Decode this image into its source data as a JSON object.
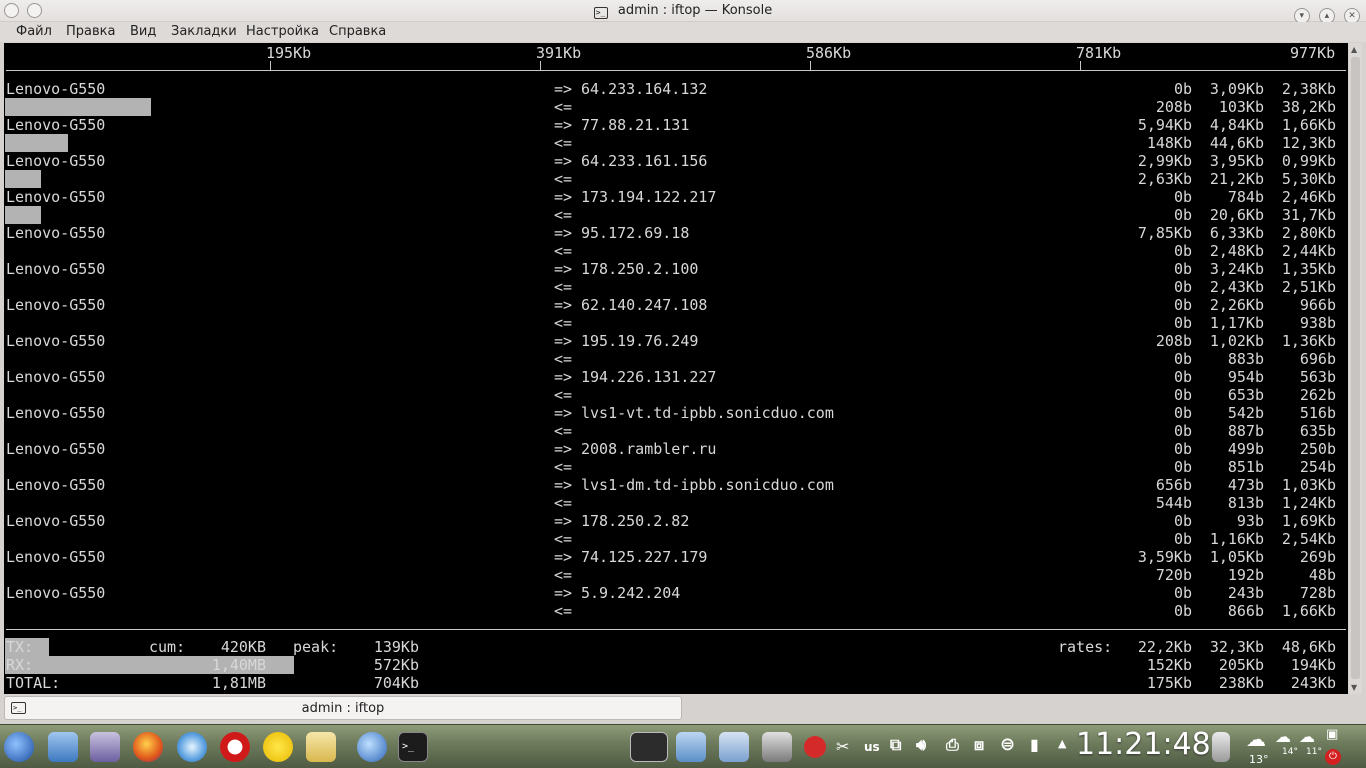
{
  "window": {
    "title": "admin : iftop — Konsole",
    "min_btn": "▾",
    "max_btn": "▴",
    "close_btn": "✕"
  },
  "menu": [
    "Файл",
    "Правка",
    "Вид",
    "Закладки",
    "Настройка",
    "Справка"
  ],
  "scale": [
    "195Kb",
    "391Kb",
    "586Kb",
    "781Kb",
    "977Kb"
  ],
  "connections": [
    {
      "host": "Lenovo-G550",
      "dest": "64.233.164.132",
      "out": [
        "0b",
        "3,09Kb",
        "2,38Kb"
      ],
      "in": [
        "208b",
        "103Kb",
        "38,2Kb"
      ],
      "bar_out": 0,
      "bar_in": 0.146
    },
    {
      "host": "Lenovo-G550",
      "dest": "77.88.21.131",
      "out": [
        "5,94Kb",
        "4,84Kb",
        "1,66Kb"
      ],
      "in": [
        "148Kb",
        "44,6Kb",
        "12,3Kb"
      ],
      "bar_out": 0,
      "bar_in": 0.063
    },
    {
      "host": "Lenovo-G550",
      "dest": "64.233.161.156",
      "out": [
        "2,99Kb",
        "3,95Kb",
        "0,99Kb"
      ],
      "in": [
        "2,63Kb",
        "21,2Kb",
        "5,30Kb"
      ],
      "bar_out": 0,
      "bar_in": 0.036
    },
    {
      "host": "Lenovo-G550",
      "dest": "173.194.122.217",
      "out": [
        "0b",
        "784b",
        "2,46Kb"
      ],
      "in": [
        "0b",
        "20,6Kb",
        "31,7Kb"
      ],
      "bar_out": 0,
      "bar_in": 0.036
    },
    {
      "host": "Lenovo-G550",
      "dest": "95.172.69.18",
      "out": [
        "7,85Kb",
        "6,33Kb",
        "2,80Kb"
      ],
      "in": [
        "0b",
        "2,48Kb",
        "2,44Kb"
      ],
      "bar_out": 0,
      "bar_in": 0
    },
    {
      "host": "Lenovo-G550",
      "dest": "178.250.2.100",
      "out": [
        "0b",
        "3,24Kb",
        "1,35Kb"
      ],
      "in": [
        "0b",
        "2,43Kb",
        "2,51Kb"
      ],
      "bar_out": 0,
      "bar_in": 0
    },
    {
      "host": "Lenovo-G550",
      "dest": "62.140.247.108",
      "out": [
        "0b",
        "2,26Kb",
        "966b"
      ],
      "in": [
        "0b",
        "1,17Kb",
        "938b"
      ],
      "bar_out": 0,
      "bar_in": 0
    },
    {
      "host": "Lenovo-G550",
      "dest": "195.19.76.249",
      "out": [
        "208b",
        "1,02Kb",
        "1,36Kb"
      ],
      "in": [
        "0b",
        "883b",
        "696b"
      ],
      "bar_out": 0,
      "bar_in": 0
    },
    {
      "host": "Lenovo-G550",
      "dest": "194.226.131.227",
      "out": [
        "0b",
        "954b",
        "563b"
      ],
      "in": [
        "0b",
        "653b",
        "262b"
      ],
      "bar_out": 0,
      "bar_in": 0
    },
    {
      "host": "Lenovo-G550",
      "dest": "lvs1-vt.td-ipbb.sonicduo.com",
      "out": [
        "0b",
        "542b",
        "516b"
      ],
      "in": [
        "0b",
        "887b",
        "635b"
      ],
      "bar_out": 0,
      "bar_in": 0
    },
    {
      "host": "Lenovo-G550",
      "dest": "2008.rambler.ru",
      "out": [
        "0b",
        "499b",
        "250b"
      ],
      "in": [
        "0b",
        "851b",
        "254b"
      ],
      "bar_out": 0,
      "bar_in": 0
    },
    {
      "host": "Lenovo-G550",
      "dest": "lvs1-dm.td-ipbb.sonicduo.com",
      "out": [
        "656b",
        "473b",
        "1,03Kb"
      ],
      "in": [
        "544b",
        "813b",
        "1,24Kb"
      ],
      "bar_out": 0,
      "bar_in": 0
    },
    {
      "host": "Lenovo-G550",
      "dest": "178.250.2.82",
      "out": [
        "0b",
        "93b",
        "1,69Kb"
      ],
      "in": [
        "0b",
        "1,16Kb",
        "2,54Kb"
      ],
      "bar_out": 0,
      "bar_in": 0
    },
    {
      "host": "Lenovo-G550",
      "dest": "74.125.227.179",
      "out": [
        "3,59Kb",
        "1,05Kb",
        "269b"
      ],
      "in": [
        "720b",
        "192b",
        "48b"
      ],
      "bar_out": 0,
      "bar_in": 0
    },
    {
      "host": "Lenovo-G550",
      "dest": "5.9.242.204",
      "out": [
        "0b",
        "243b",
        "728b"
      ],
      "in": [
        "0b",
        "866b",
        "1,66Kb"
      ],
      "bar_out": 0,
      "bar_in": 0
    }
  ],
  "out_arrow": "=>",
  "in_arrow": "<=",
  "totals": {
    "tx_label": "TX:",
    "rx_label": "RX:",
    "total_label": "TOTAL:",
    "cum_label": "cum:",
    "peak_label": "peak:",
    "rates_label": "rates:",
    "tx_cum": "420KB",
    "rx_cum": "1,40MB",
    "total_cum": "1,81MB",
    "tx_peak": "139Kb",
    "rx_peak": "572Kb",
    "total_peak": "704Kb",
    "tx_rates": [
      "22,2Kb",
      "32,3Kb",
      "48,6Kb"
    ],
    "rx_rates": [
      "152Kb",
      "205Kb",
      "194Kb"
    ],
    "total_rates": [
      "175Kb",
      "238Kb",
      "243Kb"
    ],
    "tx_bar": 0.033,
    "rx_bar": 0.216
  },
  "tab": {
    "label": "admin : iftop"
  },
  "taskbar": {
    "kbd_layout": "us",
    "clock": "11:21:48",
    "weather": [
      "13°",
      "14°",
      "11°"
    ]
  }
}
